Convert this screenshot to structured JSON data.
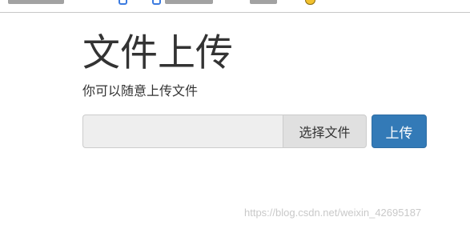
{
  "page": {
    "title": "文件上传",
    "description": "你可以随意上传文件"
  },
  "upload": {
    "file_path_value": "",
    "browse_label": "选择文件",
    "submit_label": "上传"
  },
  "watermark": {
    "text": "https://blog.csdn.net/weixin_42695187"
  },
  "colors": {
    "primary": "#337ab7",
    "primary_border": "#2e6da4",
    "text": "#333333",
    "input_bg": "#eeeeee",
    "browse_bg": "#e0e0e0",
    "watermark": "#c9c9c9"
  },
  "icons": {
    "browser_tab_icons": [
      "bookmark-icon",
      "bookmark-icon",
      "shield-icon"
    ]
  }
}
